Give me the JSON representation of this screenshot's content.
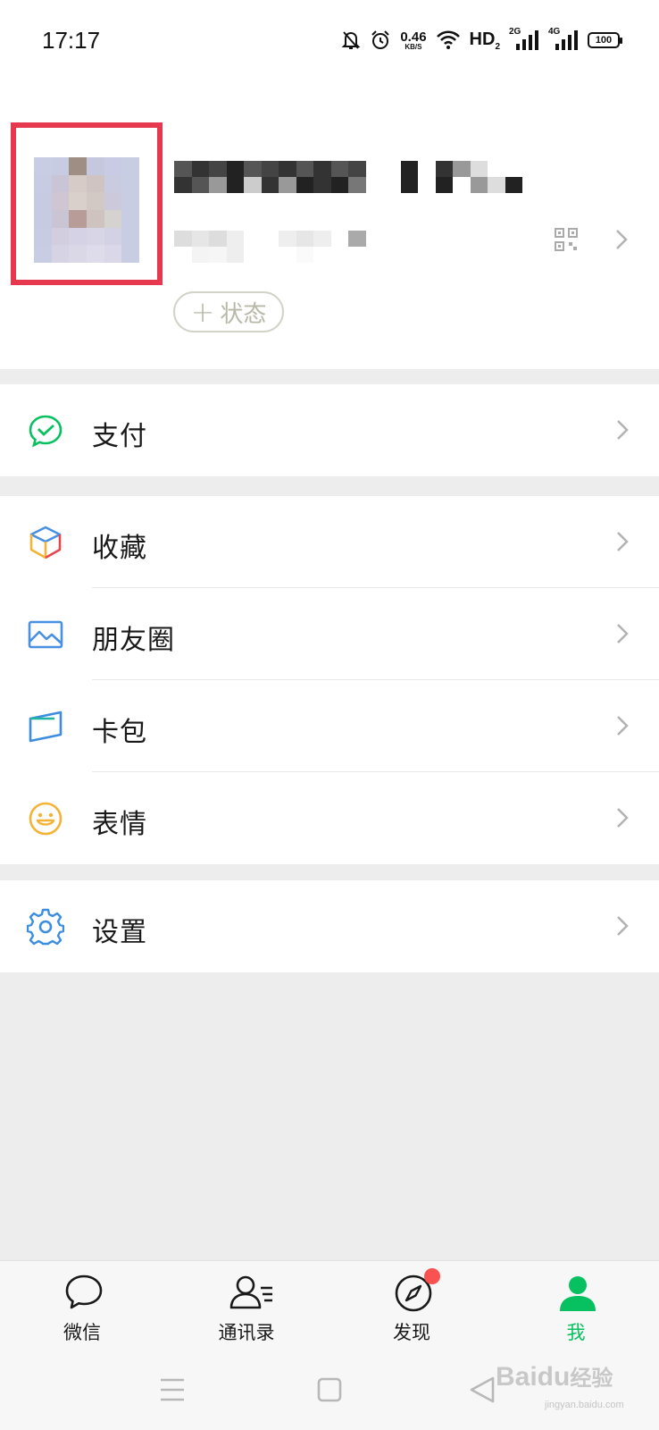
{
  "status_bar": {
    "time": "17:17",
    "net_speed": "0.46",
    "net_speed_unit": "KB/S",
    "hd_label": "HD",
    "hd_sub": "2",
    "signal_1_gen": "2G",
    "signal_2_gen": "4G",
    "battery": "100"
  },
  "profile": {
    "status_button_plus": "+",
    "status_button_label": "状态"
  },
  "menu": {
    "pay": "支付",
    "favorites": "收藏",
    "moments": "朋友圈",
    "cards": "卡包",
    "stickers": "表情",
    "settings": "设置"
  },
  "tabbar": {
    "chats": "微信",
    "contacts": "通讯录",
    "discover": "发现",
    "me": "我",
    "active_color": "#07c160",
    "badge_color": "#fa5151"
  },
  "watermark": {
    "brand": "Baidu",
    "brand_cn": "经验",
    "url": "jingyan.baidu.com"
  },
  "colors": {
    "highlight_frame": "#e8384f",
    "background": "#ededed",
    "wechat_green": "#07c160"
  }
}
